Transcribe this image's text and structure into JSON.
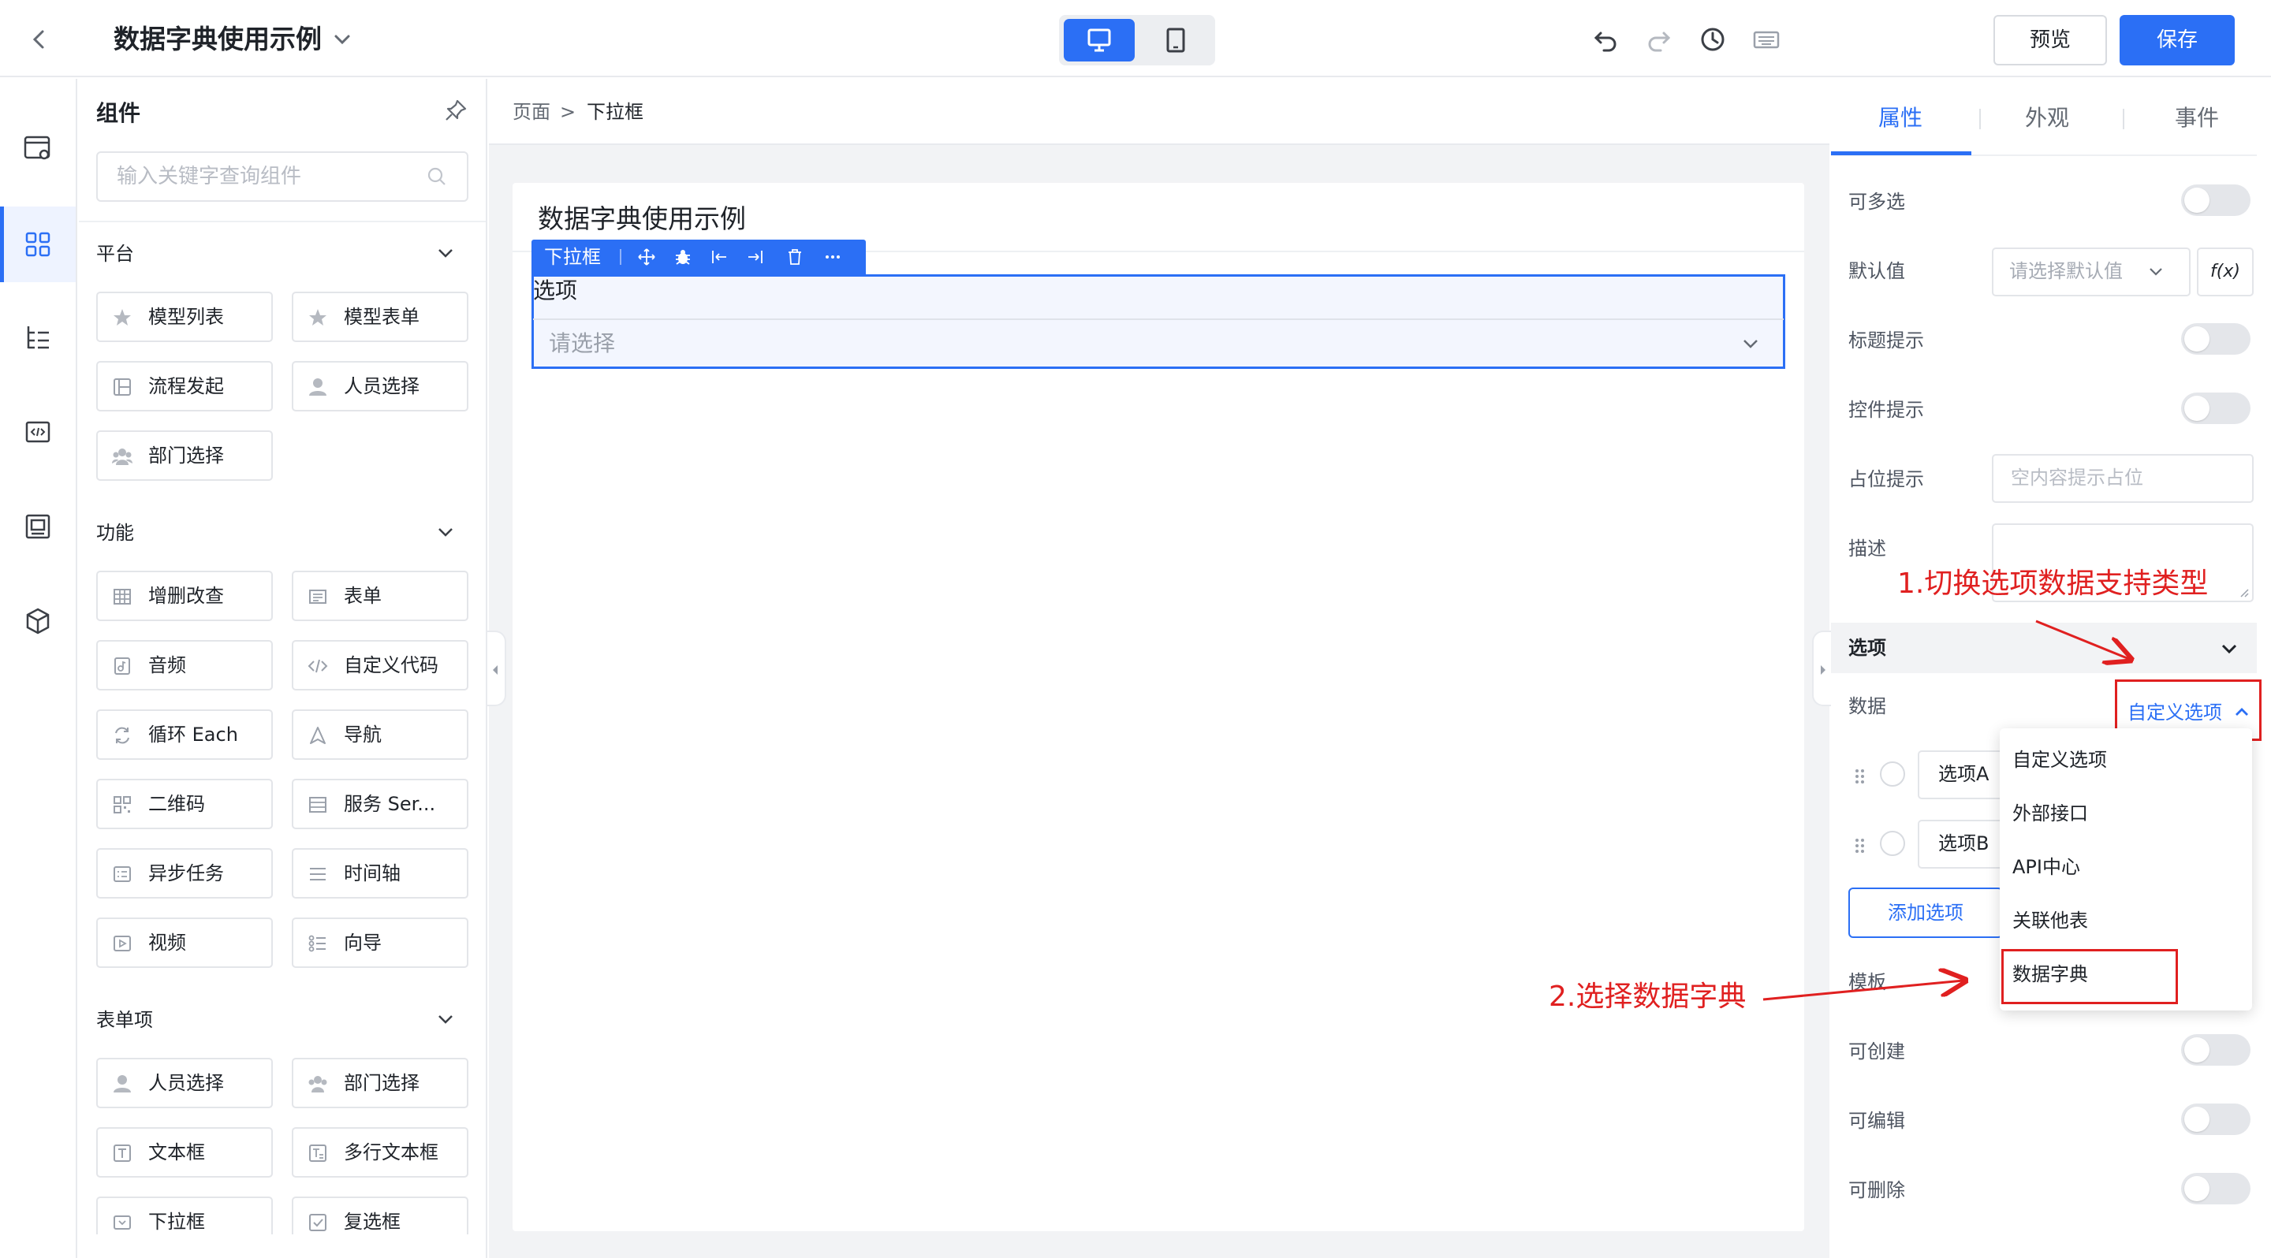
{
  "header": {
    "title": "数据字典使用示例",
    "preview_label": "预览",
    "save_label": "保存"
  },
  "components_panel": {
    "title": "组件",
    "search_placeholder": "输入关键字查询组件",
    "sections": [
      {
        "title": "平台",
        "items": [
          "模型列表",
          "模型表单",
          "流程发起",
          "人员选择",
          "部门选择"
        ]
      },
      {
        "title": "功能",
        "items": [
          "增删改查",
          "表单",
          "音频",
          "自定义代码",
          "循环 Each",
          "导航",
          "二维码",
          "服务 Ser...",
          "异步任务",
          "时间轴",
          "视频",
          "向导"
        ]
      },
      {
        "title": "表单项",
        "items": [
          "人员选择",
          "部门选择",
          "文本框",
          "多行文本框",
          "下拉框",
          "复选框"
        ]
      }
    ]
  },
  "canvas": {
    "breadcrumb": [
      "页面",
      ">",
      "下拉框"
    ],
    "page_title": "数据字典使用示例",
    "selected_component": "下拉框",
    "field_label": "选项",
    "field_placeholder": "请选择"
  },
  "properties": {
    "tabs": [
      "属性",
      "外观",
      "事件"
    ],
    "rows": {
      "multi_select": "可多选",
      "default_value": "默认值",
      "default_value_placeholder": "请选择默认值",
      "fx_label": "f(x)",
      "title_tip": "标题提示",
      "control_tip": "控件提示",
      "placeholder_tip": "占位提示",
      "placeholder_tip_placeholder": "空内容提示占位",
      "description": "描述"
    },
    "options_section": {
      "title": "选项",
      "data_label": "数据",
      "data_type": "自定义选项",
      "options": [
        "选项A",
        "选项B"
      ],
      "add_option_label": "添加选项",
      "template_label": "模板"
    },
    "bottom_rows": [
      "可创建",
      "可编辑",
      "可删除"
    ],
    "dropdown_items": [
      "自定义选项",
      "外部接口",
      "API中心",
      "关联他表",
      "数据字典"
    ]
  },
  "annotations": {
    "step1": "1.切换选项数据支持类型",
    "step2": "2.选择数据字典"
  },
  "colors": {
    "accent": "#2b6ff5",
    "annotation": "#e02020"
  }
}
